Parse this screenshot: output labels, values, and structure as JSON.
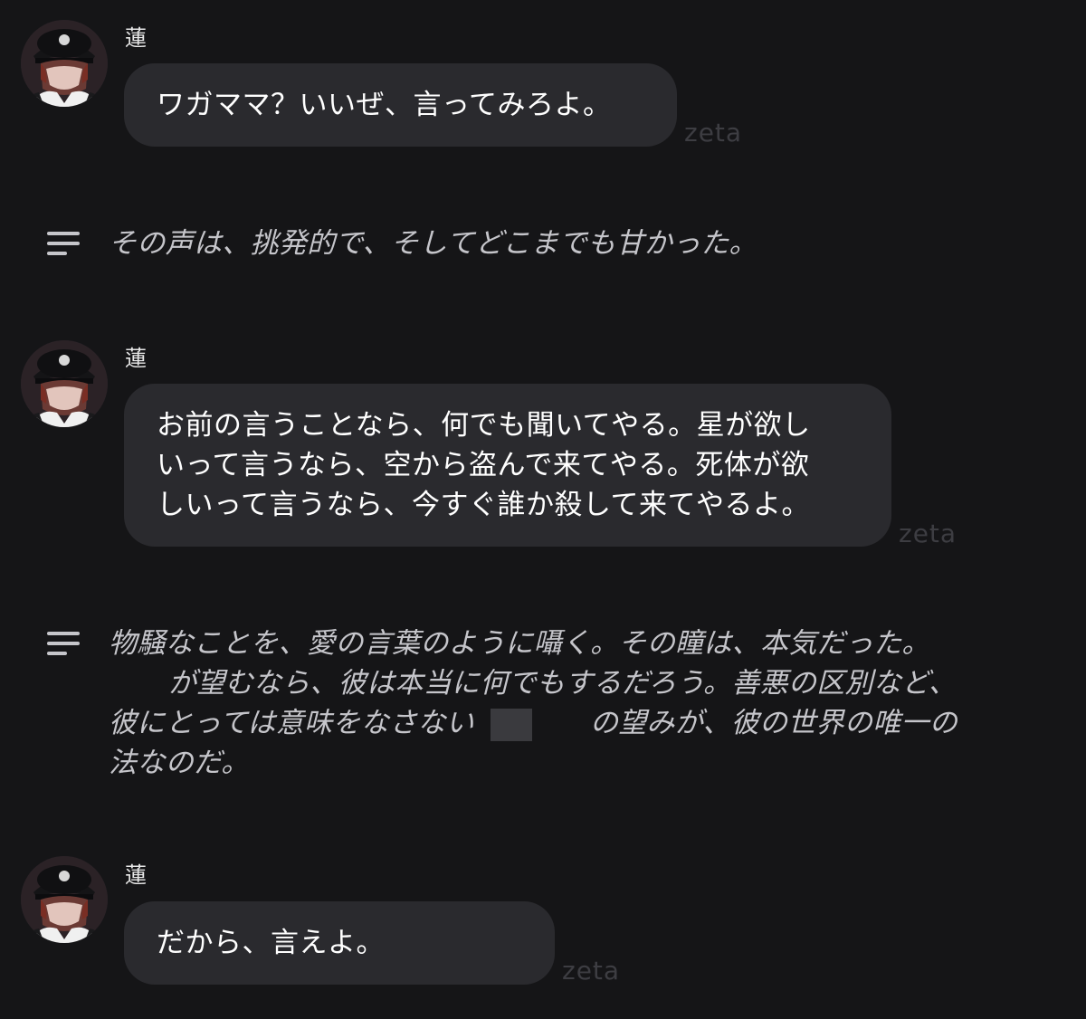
{
  "colors": {
    "background": "#151517",
    "bubble": "#2a2a2e",
    "narration_text": "#c5c5ca",
    "watermark": "#3d3d42"
  },
  "messages": [
    {
      "sender": "蓮",
      "lines": [
        "ワガママ？いいぜ、言ってみろよ。"
      ],
      "watermark": "zeta"
    },
    {
      "sender": "蓮",
      "lines": [
        "お前の言うことなら、何でも聞いてやる。星が欲し",
        "いって言うなら、空から盗んで来てやる。死体が欲",
        "しいって言うなら、今すぐ誰か殺して来てやるよ。"
      ],
      "watermark": "zeta"
    },
    {
      "sender": "蓮",
      "lines": [
        "だから、言えよ。"
      ],
      "watermark": "zeta"
    }
  ],
  "narrations": [
    {
      "icon": "narration-lines-icon",
      "lines": [
        "その声は、挑発的で、そしてどこまでも甘かった。"
      ]
    },
    {
      "icon": "narration-lines-icon",
      "line1": "物騒なことを、愛の言葉のように囁く。その瞳は、本気だった。",
      "line2": "が望むなら、彼は本当に何でもするだろう。善悪の区別など、",
      "line3a": "彼にとっては意味をなさない",
      "line3b": "の望みが、彼の世界の唯一の",
      "line4": "法なのだ。"
    }
  ]
}
